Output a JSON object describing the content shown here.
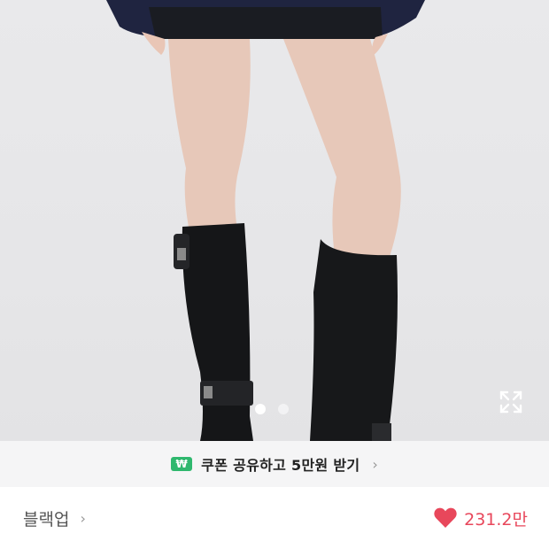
{
  "image": {
    "description_icon": "product-photo",
    "pagination": {
      "total": 2,
      "active_index": 0
    },
    "expand_icon": "expand-icon"
  },
  "coupon_banner": {
    "badge": "₩",
    "text": "쿠폰 공유하고 5만원 받기",
    "chevron": "›",
    "accent_color": "#2fb86e"
  },
  "brand_row": {
    "brand_name": "블랙업",
    "brand_chevron": "›",
    "likes_icon": "heart-icon",
    "likes_count": "231.2만",
    "likes_color": "#e8475b"
  }
}
